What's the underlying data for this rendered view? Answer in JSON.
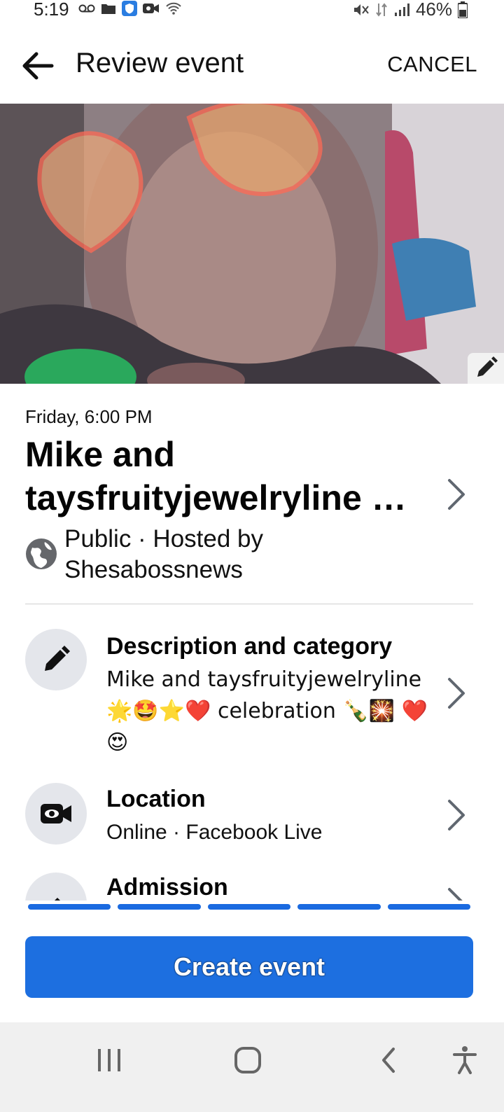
{
  "status_bar": {
    "time": "5:19",
    "battery": "46%"
  },
  "header": {
    "title": "Review event",
    "cancel_label": "CANCEL"
  },
  "event": {
    "date": "Friday, 6:00 PM",
    "title": "Mike and taysfruityjewelryline …",
    "privacy": "Public · Hosted by Shesabossnews"
  },
  "rows": [
    {
      "title": "Description and category",
      "subtitle": "Mike and taysfruityjewelryline 🌟🤩⭐❤️ celebration 🍾🎇 ❤️😍",
      "icon": "pencil-icon"
    },
    {
      "title": "Location",
      "subtitle": "Online · Facebook Live",
      "icon": "video-camera-icon"
    },
    {
      "title": "Admission",
      "subtitle": "",
      "icon": "ticket-icon"
    }
  ],
  "progress": {
    "segments_total": 5,
    "segments_complete": 5
  },
  "create_button_label": "Create event",
  "colors": {
    "accent": "#1d6fe0",
    "icon_circle": "#e4e6eb",
    "nav_bg": "#f0f0f0"
  }
}
